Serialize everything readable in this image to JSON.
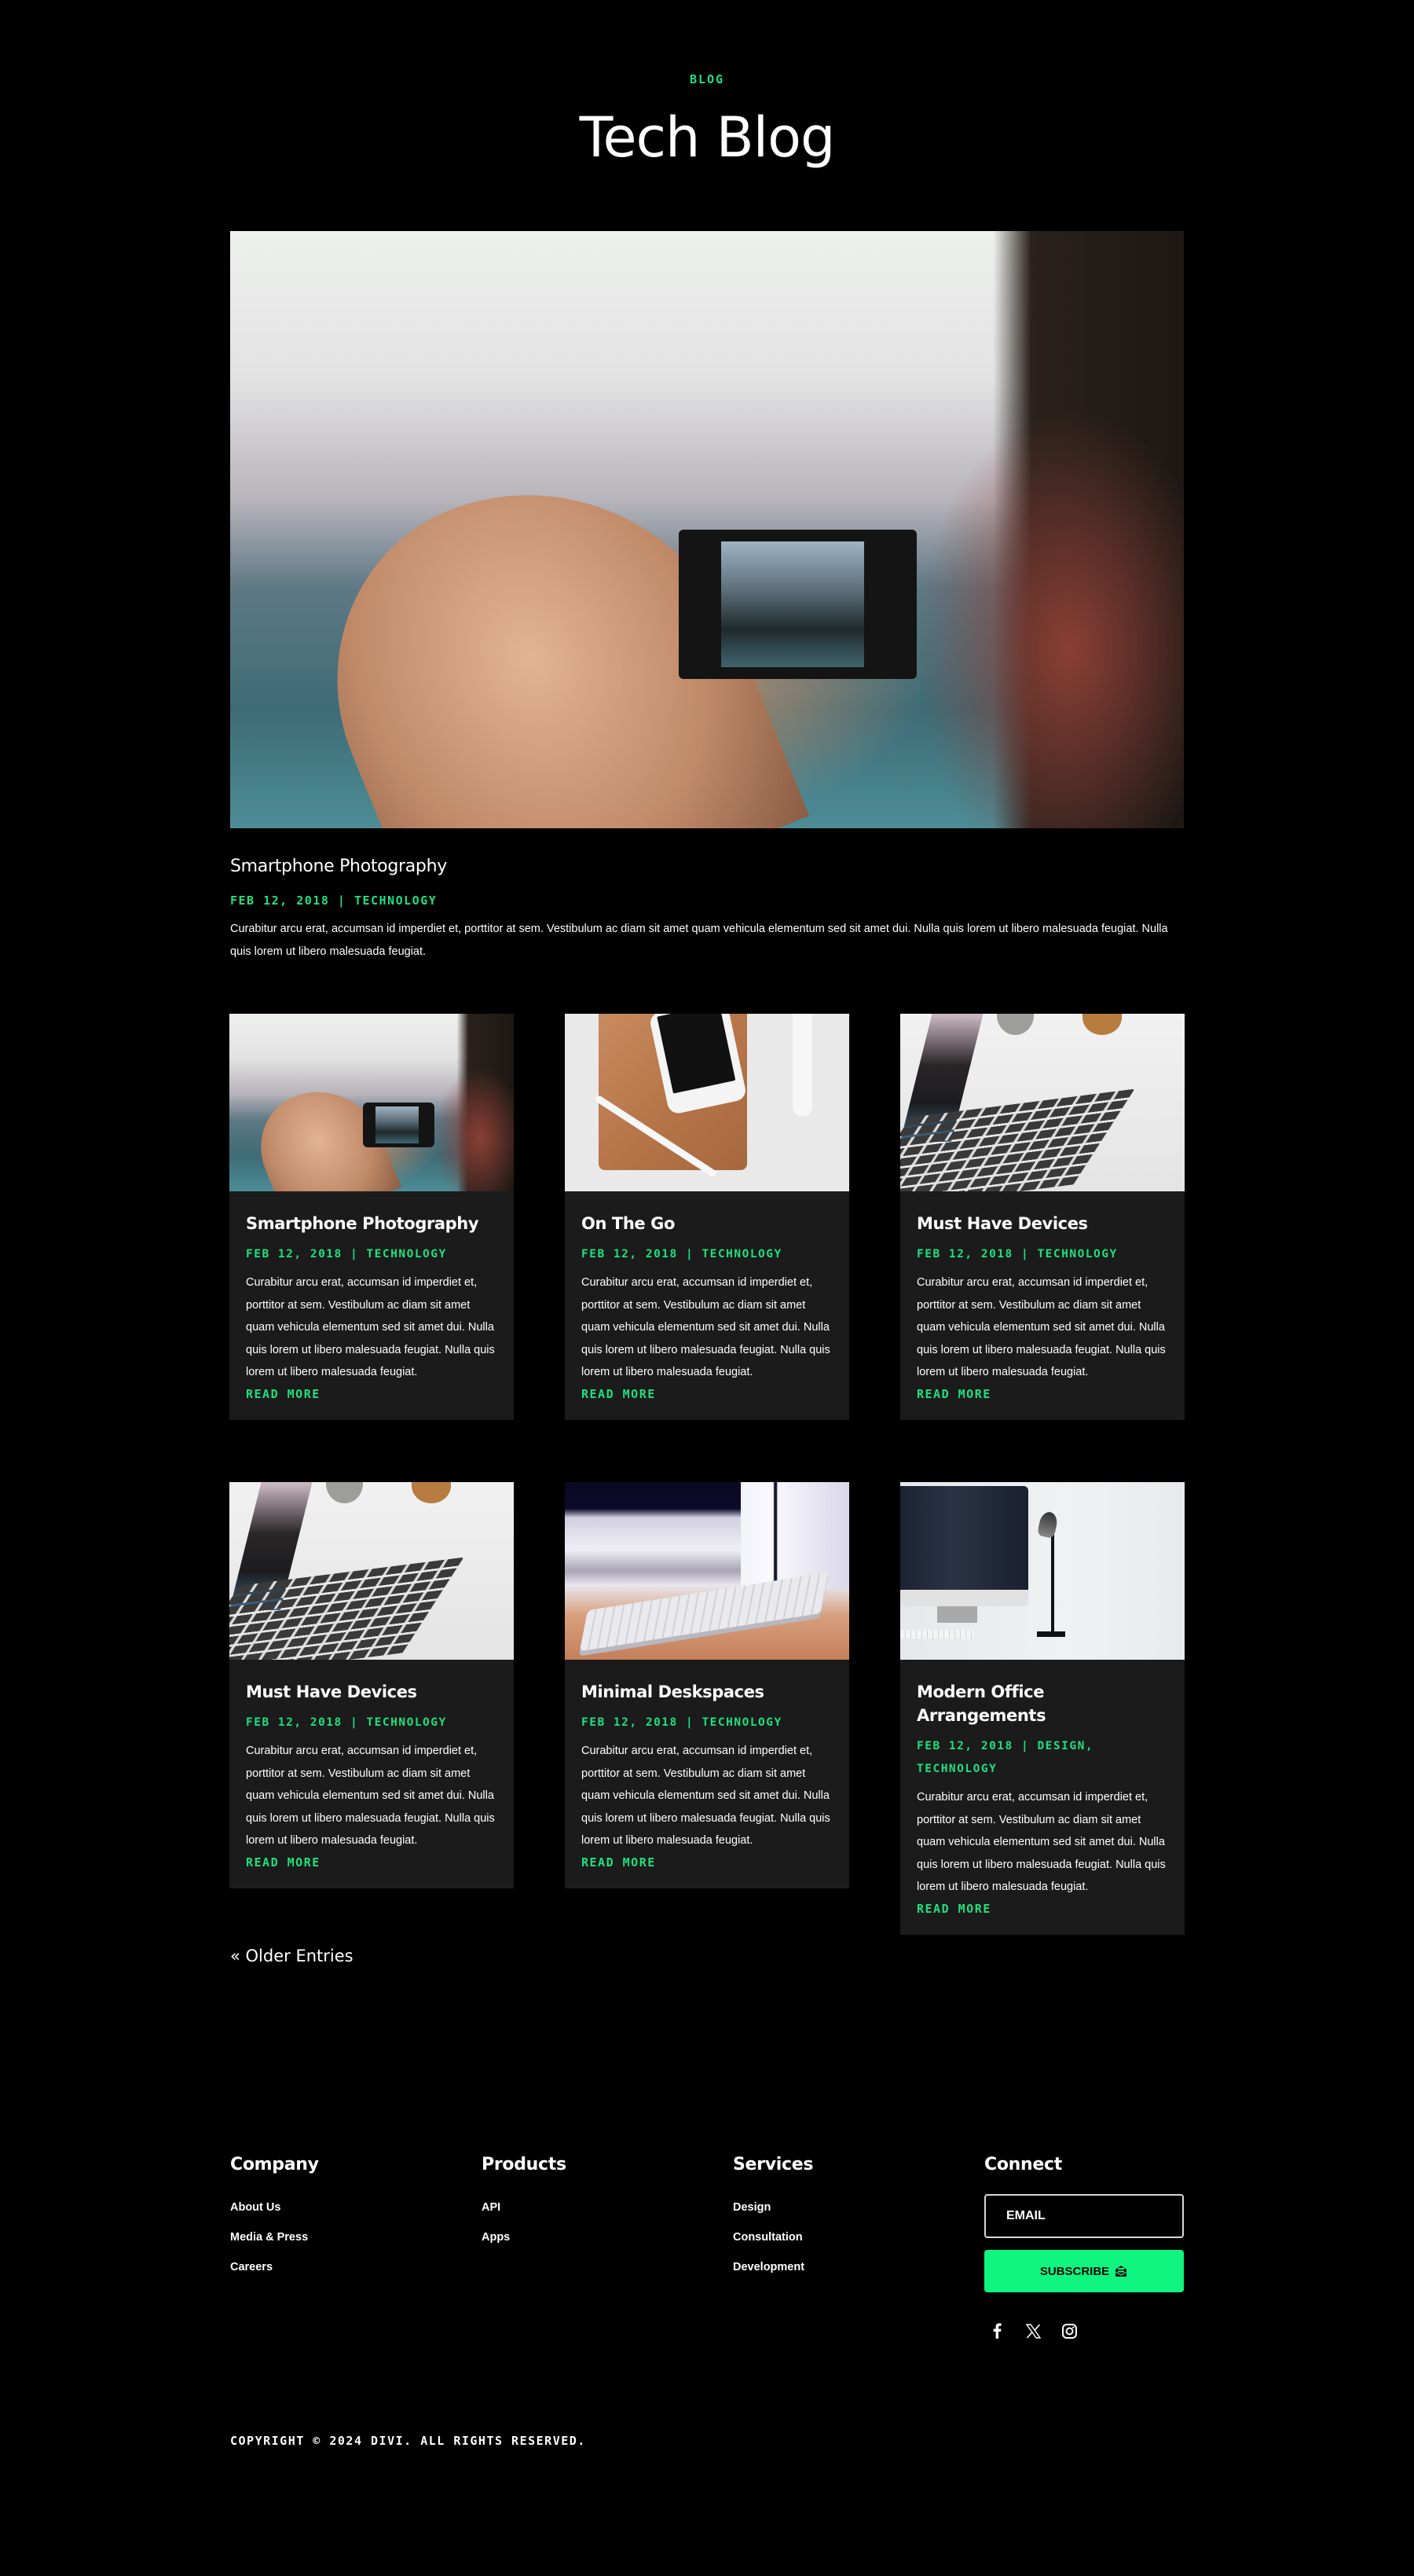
{
  "header": {
    "eyebrow": "BLOG",
    "title": "Tech Blog"
  },
  "colors": {
    "accent": "#1fe07e",
    "button": "#0ff57f",
    "card_bg": "#1b1b1b",
    "page_bg": "#000000"
  },
  "featured": {
    "image": "hands-taking-smartphone-photo-of-mountain-lake",
    "title": "Smartphone Photography",
    "meta": "FEB 12, 2018 | TECHNOLOGY",
    "excerpt": "Curabitur arcu erat, accumsan id imperdiet et, porttitor at sem. Vestibulum ac diam sit amet quam vehicula elementum sed sit amet dui. Nulla quis lorem ut libero malesuada feugiat. Nulla quis lorem ut libero malesuada feugiat."
  },
  "posts": [
    {
      "image": "hands-taking-smartphone-photo",
      "title": "Smartphone Photography",
      "meta": "FEB 12, 2018 | TECHNOLOGY",
      "excerpt": "Curabitur arcu erat, accumsan id imperdiet et, porttitor at sem. Vestibulum ac diam sit amet quam vehicula elementum sed sit amet dui. Nulla quis lorem ut libero malesuada feugiat. Nulla quis lorem ut libero malesuada feugiat.",
      "read_more": "READ MORE"
    },
    {
      "image": "tablet-phone-pencil-watch-on-desk",
      "title": "On The Go",
      "meta": "FEB 12, 2018 | TECHNOLOGY",
      "excerpt": "Curabitur arcu erat, accumsan id imperdiet et, porttitor at sem. Vestibulum ac diam sit amet quam vehicula elementum sed sit amet dui. Nulla quis lorem ut libero malesuada feugiat. Nulla quis lorem ut libero malesuada feugiat.",
      "read_more": "READ MORE"
    },
    {
      "image": "laptop-keyboard-closeup",
      "title": "Must Have Devices",
      "meta": "FEB 12, 2018 | TECHNOLOGY",
      "excerpt": "Curabitur arcu erat, accumsan id imperdiet et, porttitor at sem. Vestibulum ac diam sit amet quam vehicula elementum sed sit amet dui. Nulla quis lorem ut libero malesuada feugiat. Nulla quis lorem ut libero malesuada feugiat.",
      "read_more": "READ MORE"
    },
    {
      "image": "laptop-keyboard-closeup",
      "title": "Must Have Devices",
      "meta": "FEB 12, 2018 | TECHNOLOGY",
      "excerpt": "Curabitur arcu erat, accumsan id imperdiet et, porttitor at sem. Vestibulum ac diam sit amet quam vehicula elementum sed sit amet dui. Nulla quis lorem ut libero malesuada feugiat. Nulla quis lorem ut libero malesuada feugiat.",
      "read_more": "READ MORE"
    },
    {
      "image": "wireless-keyboard-on-wooden-desk",
      "title": "Minimal Deskspaces",
      "meta": "FEB 12, 2018 | TECHNOLOGY",
      "excerpt": "Curabitur arcu erat, accumsan id imperdiet et, porttitor at sem. Vestibulum ac diam sit amet quam vehicula elementum sed sit amet dui. Nulla quis lorem ut libero malesuada feugiat. Nulla quis lorem ut libero malesuada feugiat.",
      "read_more": "READ MORE"
    },
    {
      "image": "monitor-and-desk-lamp",
      "title": "Modern Office Arrangements",
      "meta": "FEB 12, 2018 | DESIGN, TECHNOLOGY",
      "excerpt": "Curabitur arcu erat, accumsan id imperdiet et, porttitor at sem. Vestibulum ac diam sit amet quam vehicula elementum sed sit amet dui. Nulla quis lorem ut libero malesuada feugiat. Nulla quis lorem ut libero malesuada feugiat.",
      "read_more": "READ MORE"
    }
  ],
  "pagination": {
    "older_entries": "« Older Entries"
  },
  "footer": {
    "company": {
      "heading": "Company",
      "links": [
        "About Us",
        "Media & Press",
        "Careers"
      ]
    },
    "products": {
      "heading": "Products",
      "links": [
        "API",
        "Apps"
      ]
    },
    "services": {
      "heading": "Services",
      "links": [
        "Design",
        "Consultation",
        "Development"
      ]
    },
    "connect": {
      "heading": "Connect",
      "email_placeholder": "EMAIL",
      "email_value": "",
      "subscribe_label": "SUBSCRIBE",
      "subscribe_icon": "mail-open-icon",
      "social": [
        "facebook-icon",
        "x-twitter-icon",
        "instagram-icon"
      ]
    },
    "copyright": "COPYRIGHT © 2024 DIVI. ALL RIGHTS RESERVED."
  }
}
